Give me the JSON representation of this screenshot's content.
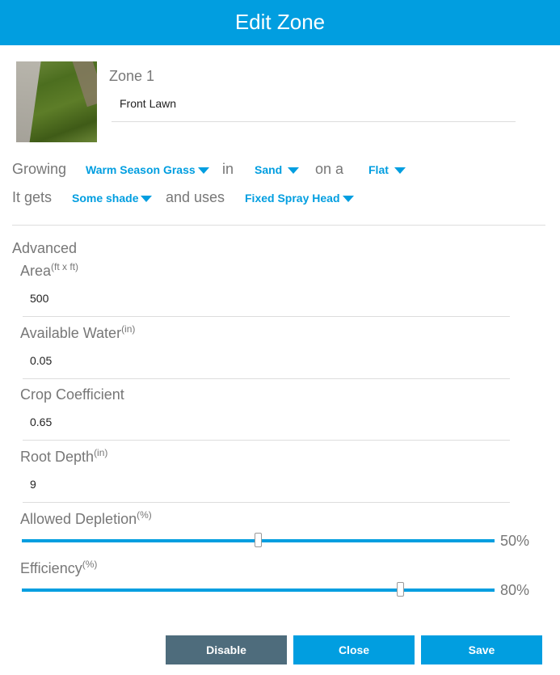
{
  "header": {
    "title": "Edit Zone"
  },
  "zone": {
    "label": "Zone 1",
    "name": "Front Lawn"
  },
  "sentence": {
    "growing": "Growing",
    "plant_type": "Warm Season Grass",
    "in": "in",
    "soil": "Sand",
    "on_a": "on a",
    "slope": "Flat",
    "it_gets": "It gets",
    "exposure": "Some shade",
    "and_uses": "and uses",
    "sprinkler": "Fixed Spray Head"
  },
  "advanced": {
    "title": "Advanced",
    "area": {
      "label": "Area",
      "unit": "(ft x ft)",
      "value": "500"
    },
    "available_water": {
      "label": "Available Water",
      "unit": "(in)",
      "value": "0.05"
    },
    "crop_coefficient": {
      "label": "Crop Coefficient",
      "value": "0.65"
    },
    "root_depth": {
      "label": "Root Depth",
      "unit": "(in)",
      "value": "9"
    },
    "allowed_depletion": {
      "label": "Allowed Depletion",
      "unit": "(%)",
      "value_text": "50%",
      "value": 50
    },
    "efficiency": {
      "label": "Efficiency",
      "unit": "(%)",
      "value_text": "80%",
      "value": 80
    }
  },
  "buttons": {
    "disable": "Disable",
    "close": "Close",
    "save": "Save"
  },
  "colors": {
    "accent": "#019ee0",
    "disable_button": "#4e6c7c"
  }
}
